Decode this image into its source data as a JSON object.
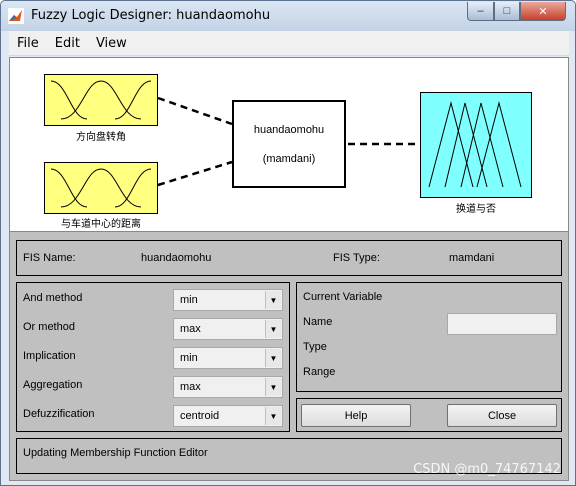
{
  "window": {
    "title": "Fuzzy Logic Designer: huandaomohu"
  },
  "menu": {
    "items": [
      "File",
      "Edit",
      "View"
    ]
  },
  "diagram": {
    "inputs": [
      "方向盘转角",
      "与车道中心的距离"
    ],
    "output": "换道与否",
    "system_name": "huandaomohu",
    "system_type": "(mamdani)"
  },
  "fis": {
    "name_label": "FIS Name:",
    "name_value": "huandaomohu",
    "type_label": "FIS Type:",
    "type_value": "mamdani"
  },
  "methods": [
    {
      "label": "And method",
      "value": "min"
    },
    {
      "label": "Or method",
      "value": "max"
    },
    {
      "label": "Implication",
      "value": "min"
    },
    {
      "label": "Aggregation",
      "value": "max"
    },
    {
      "label": "Defuzzification",
      "value": "centroid"
    }
  ],
  "current_variable": {
    "title": "Current Variable",
    "name_label": "Name",
    "type_label": "Type",
    "range_label": "Range",
    "name_value": ""
  },
  "buttons": {
    "help": "Help",
    "close": "Close"
  },
  "status": {
    "text": "Updating Membership Function Editor"
  },
  "watermark": "CSDN @m0_74767142",
  "colors": {
    "input_block": "#ffff80",
    "output_block": "#80ffff",
    "panel": "#c0c0c0"
  }
}
